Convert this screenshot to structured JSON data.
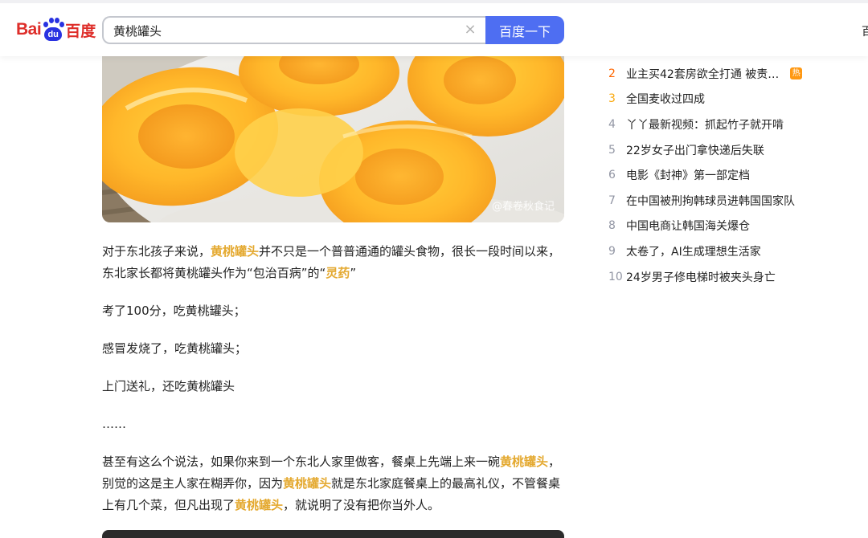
{
  "header": {
    "logo_bai": "Bai",
    "logo_du": "du",
    "logo_cn": "百度",
    "search_value": "黄桃罐头",
    "clear_icon": "close-icon",
    "search_button": "百度一下",
    "edge_text": "百"
  },
  "image": {
    "watermark": "@春卷秋食记"
  },
  "article": {
    "p1_before": "对于东北孩子来说，",
    "p1_hl1": "黄桃罐头",
    "p1_mid": "并不只是一个普普通通的罐头食物，很长一段时间以来，东北家长都将黄桃罐头作为“包治百病”的“",
    "p1_hl2": "灵药",
    "p1_end": "”",
    "p2": "考了100分，吃黄桃罐头；",
    "p3": "感冒发烧了，吃黄桃罐头；",
    "p4": "上门送礼，还吃黄桃罐头",
    "p5": "……",
    "p6_a": "甚至有这么个说法，如果你来到一个东北人家里做客，餐桌上先端上来一碗",
    "p6_hl1": "黄桃罐头",
    "p6_b": "，别觉的这是主人家在糊弄你，因为",
    "p6_hl2": "黄桃罐头",
    "p6_c": "就是东北家庭餐桌上的最高礼仪，不管餐桌上有几个菜，但凡出现了",
    "p6_hl3": "黄桃罐头",
    "p6_d": "，就说明了没有把你当外人。"
  },
  "hot_list": [
    {
      "rank": "2",
      "title": "业主买42套房欲全打通 被责…",
      "badge": "热"
    },
    {
      "rank": "3",
      "title": "全国麦收过四成"
    },
    {
      "rank": "4",
      "title": "丫丫最新视频：抓起竹子就开啃"
    },
    {
      "rank": "5",
      "title": "22岁女子出门拿快递后失联"
    },
    {
      "rank": "6",
      "title": "电影《封神》第一部定档"
    },
    {
      "rank": "7",
      "title": "在中国被刑拘韩球员进韩国国家队"
    },
    {
      "rank": "8",
      "title": "中国电商让韩国海关爆仓"
    },
    {
      "rank": "9",
      "title": "太卷了，AI生成理想生活家"
    },
    {
      "rank": "10",
      "title": "24岁男子修电梯时被夹头身亡"
    }
  ],
  "colors": {
    "brand_red": "#de2e2a",
    "brand_blue": "#2932e1",
    "search_button": "#4e6ef2",
    "highlight": "#e4a930",
    "rank_top2": "#ff6600",
    "rank_top3": "#faa90e",
    "badge_hot": "#ff9812"
  }
}
